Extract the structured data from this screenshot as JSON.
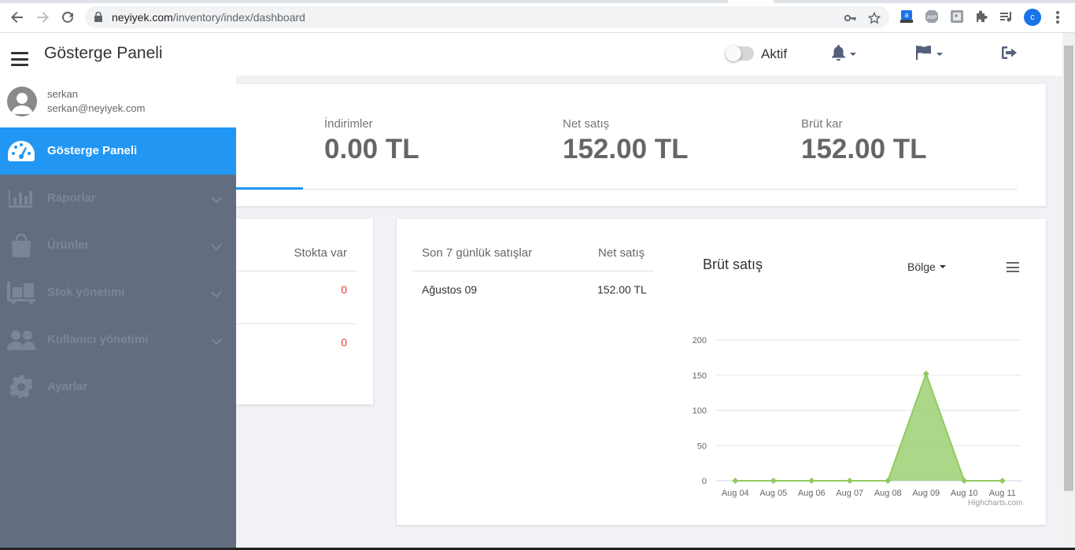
{
  "browser": {
    "url_host": "neyiyek.com",
    "url_path": "/inventory/index/dashboard",
    "profile_initial": "c",
    "ext_abp": "ABP"
  },
  "header": {
    "title": "Gösterge Paneli",
    "toggle_label": "Aktif"
  },
  "user": {
    "name": "serkan",
    "email": "serkan@neyiyek.com"
  },
  "sidebar": {
    "items": [
      {
        "label": "Gösterge Paneli",
        "icon": "dashboard-gauge-icon",
        "active": true
      },
      {
        "label": "Raporlar",
        "icon": "bar-chart-icon"
      },
      {
        "label": "Ürünler",
        "icon": "shopping-bag-icon"
      },
      {
        "label": "Stok yönetimi",
        "icon": "pallet-icon"
      },
      {
        "label": "Kullanıcı yönetimi",
        "icon": "users-icon"
      },
      {
        "label": "Ayarlar",
        "icon": "gear-icon"
      }
    ]
  },
  "stats": [
    {
      "label": "İndirimler",
      "value": "0.00 TL"
    },
    {
      "label": "Net satış",
      "value": "152.00 TL"
    },
    {
      "label": "Brüt kar",
      "value": "152.00 TL"
    }
  ],
  "stock_table": {
    "header": "Stokta var",
    "rows": [
      "0",
      "0"
    ]
  },
  "sales_table": {
    "headers": [
      "Son 7 günlük satışlar",
      "Net satış"
    ],
    "rows": [
      [
        "Ağustos 09",
        "152.00 TL"
      ]
    ]
  },
  "chart_header": {
    "title": "Brüt satış",
    "dropdown_label": "Bölge",
    "credit": "Highcharts.com"
  },
  "chart_data": {
    "type": "area",
    "title": "Brüt satış",
    "categories": [
      "Aug 04",
      "Aug 05",
      "Aug 06",
      "Aug 07",
      "Aug 08",
      "Aug 09",
      "Aug 10",
      "Aug 11"
    ],
    "series": [
      {
        "values": [
          0,
          0,
          0,
          0,
          0,
          152,
          0,
          0
        ]
      }
    ],
    "ylim": [
      0,
      200
    ],
    "yticks": [
      0,
      50,
      100,
      150,
      200
    ],
    "grid": true,
    "color": "#90ca60"
  },
  "colors": {
    "accent": "#2196f3",
    "sidebar": "#626e80",
    "series": "#90ca60"
  }
}
